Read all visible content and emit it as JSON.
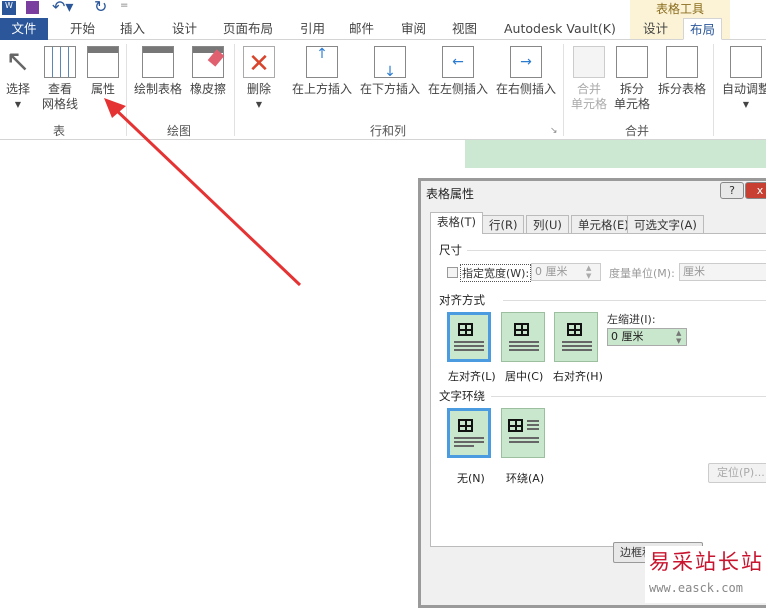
{
  "qat": {
    "icons": [
      "word-icon",
      "save-icon",
      "undo-icon",
      "redo-icon",
      "customize-icon"
    ]
  },
  "context_tab": "表格工具",
  "tabs": [
    "文件",
    "开始",
    "插入",
    "设计",
    "页面布局",
    "引用",
    "邮件",
    "审阅",
    "视图",
    "Autodesk Vault(K)",
    "设计",
    "布局"
  ],
  "ribbon": {
    "buttons": [
      {
        "l1": "选择",
        "l2": ""
      },
      {
        "l1": "查看",
        "l2": "网格线"
      },
      {
        "l1": "属性",
        "l2": ""
      },
      {
        "l1": "绘制表格",
        "l2": ""
      },
      {
        "l1": "橡皮擦",
        "l2": ""
      },
      {
        "l1": "删除",
        "l2": ""
      },
      {
        "l1": "在上方插入",
        "l2": ""
      },
      {
        "l1": "在下方插入",
        "l2": ""
      },
      {
        "l1": "在左侧插入",
        "l2": ""
      },
      {
        "l1": "在右侧插入",
        "l2": ""
      },
      {
        "l1": "合并",
        "l2": "单元格"
      },
      {
        "l1": "拆分",
        "l2": "单元格"
      },
      {
        "l1": "拆分表格",
        "l2": ""
      },
      {
        "l1": "自动调整",
        "l2": ""
      }
    ],
    "groups": [
      "表",
      "绘图",
      "行和列",
      "合并"
    ]
  },
  "dialog": {
    "title": "表格属性",
    "help": "?",
    "close": "x",
    "tabs": [
      "表格(T)",
      "行(R)",
      "列(U)",
      "单元格(E)",
      "可选文字(A)"
    ],
    "size_label": "尺寸",
    "width_check": "指定宽度(W):",
    "width_value": "0 厘米",
    "unit_label": "度量单位(M):",
    "unit_value": "厘米",
    "align_label": "对齐方式",
    "align_options": [
      "左对齐(L)",
      "居中(C)",
      "右对齐(H)"
    ],
    "indent_label": "左缩进(I):",
    "indent_value": "0 厘米",
    "wrap_label": "文字环绕",
    "wrap_options": [
      "无(N)",
      "环绕(A)"
    ],
    "position_btn": "定位(P)...",
    "borders_btn": "边框和"
  },
  "watermark": {
    "cn": "易采站长站",
    "url": "www.easck.com"
  }
}
